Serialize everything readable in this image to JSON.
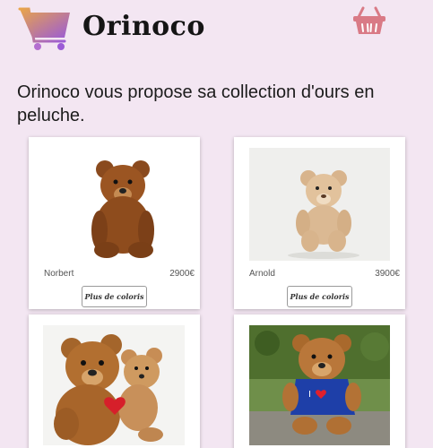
{
  "header": {
    "brand": "Orinoco",
    "logo_icon": "shopping-cart-icon",
    "basket_icon": "basket-icon"
  },
  "intro": {
    "text": "Orinoco vous propose sa collection d'ours en peluche."
  },
  "products": [
    {
      "name": "Norbert",
      "price": "2900€",
      "button": "Plus de coloris"
    },
    {
      "name": "Arnold",
      "price": "3900€",
      "button": "Plus de coloris"
    },
    {
      "name": "",
      "price": "",
      "button": ""
    },
    {
      "name": "",
      "price": "",
      "button": ""
    }
  ],
  "colors": {
    "background": "#f3e6f2",
    "cart_gradient_start": "#e9a54a",
    "cart_gradient_end": "#9b5bd6",
    "basket": "#d97a86"
  }
}
